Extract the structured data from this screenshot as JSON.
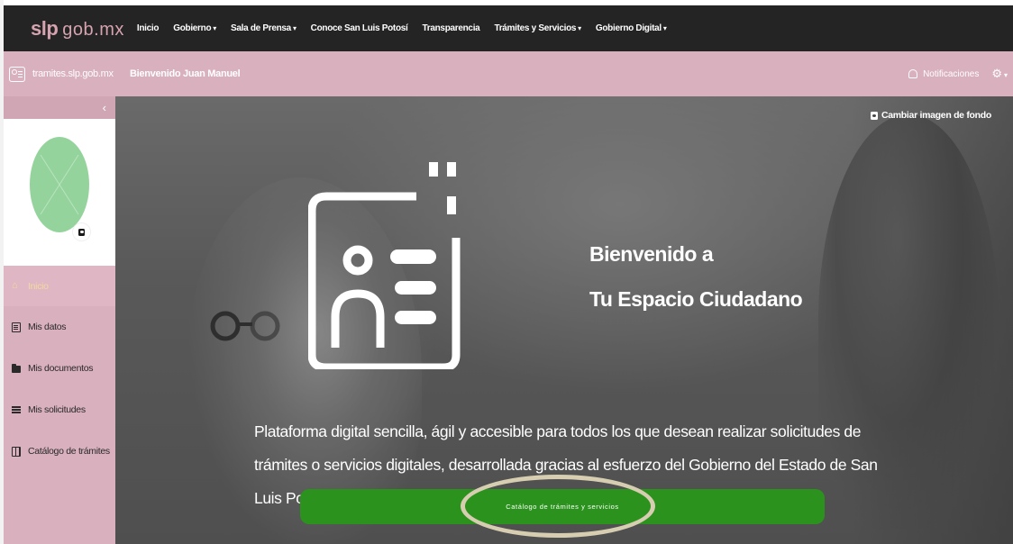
{
  "topnav": {
    "brand_strong": "slp",
    "brand_light": "gob.mx",
    "items": [
      {
        "label": "Inicio",
        "dropdown": false
      },
      {
        "label": "Gobierno",
        "dropdown": true
      },
      {
        "label": "Sala de Prensa",
        "dropdown": true
      },
      {
        "label": "Conoce San Luis Potosí",
        "dropdown": false
      },
      {
        "label": "Transparencia",
        "dropdown": false
      },
      {
        "label": "Trámites y Servicios",
        "dropdown": true
      },
      {
        "label": "Gobierno Digital",
        "dropdown": true
      }
    ]
  },
  "header": {
    "site": "tramites.slp.gob.mx",
    "welcome": "Bienvenido Juan Manuel",
    "notifications": "Notificaciones"
  },
  "sidebar": {
    "items": [
      {
        "label": "Inicio",
        "icon": "home-icon",
        "active": true
      },
      {
        "label": "Mis datos",
        "icon": "id-card-icon",
        "active": false
      },
      {
        "label": "Mis documentos",
        "icon": "folder-icon",
        "active": false
      },
      {
        "label": "Mis solicitudes",
        "icon": "list-icon",
        "active": false
      },
      {
        "label": "Catálogo de trámites",
        "icon": "book-icon",
        "active": false
      }
    ]
  },
  "hero": {
    "change_background": "Cambiar imagen de fondo",
    "title_line1": "Bienvenido a",
    "title_line2": "Tu Espacio Ciudadano",
    "description": "Plataforma digital sencilla, ágil y accesible para todos los que desean realizar solicitudes de trámites o servicios digitales, desarrollada gracias al esfuerzo del Gobierno del Estado de San Luis Potosí.",
    "cta": "Catálogo de trámites y servicios"
  },
  "colors": {
    "topnav_bg": "#242424",
    "brand": "#d6a3b0",
    "pink": "#d9b0bd",
    "cta_green": "#2c921e",
    "avatar_green": "#94d49c"
  }
}
